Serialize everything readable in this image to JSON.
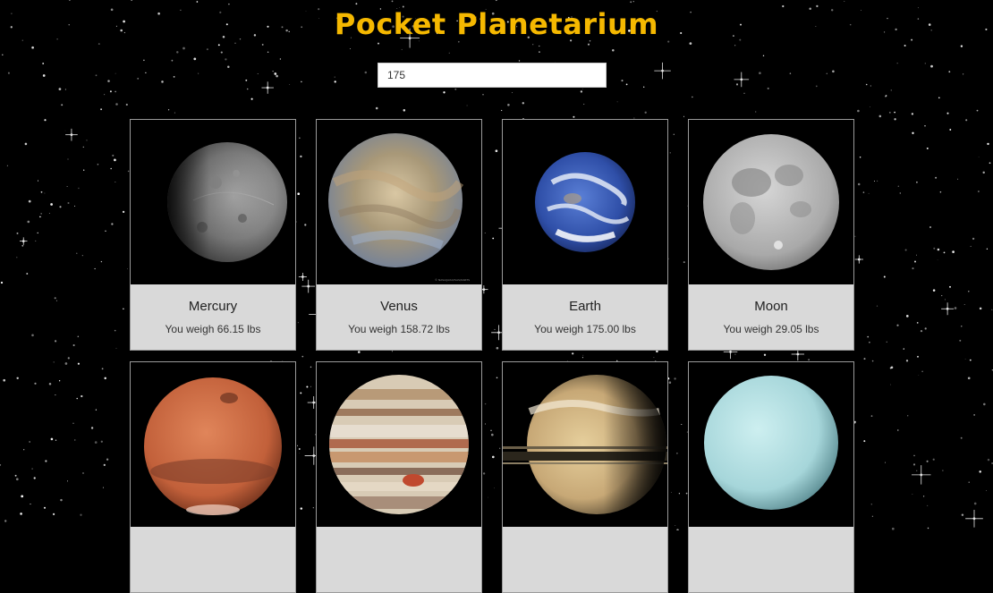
{
  "header": {
    "title": "Pocket Planetarium"
  },
  "search": {
    "value": "175"
  },
  "cards": [
    {
      "name": "Mercury",
      "weight_text": "You weigh 66.15 lbs"
    },
    {
      "name": "Venus",
      "weight_text": "You weigh 158.72 lbs"
    },
    {
      "name": "Earth",
      "weight_text": "You weigh 175.00 lbs"
    },
    {
      "name": "Moon",
      "weight_text": "You weigh 29.05 lbs"
    },
    {
      "name": "",
      "weight_text": ""
    },
    {
      "name": "",
      "weight_text": ""
    },
    {
      "name": "",
      "weight_text": ""
    },
    {
      "name": "",
      "weight_text": ""
    }
  ],
  "colors": {
    "title": "#f5b800",
    "card_info_bg": "#d9d9d9",
    "background": "#000000"
  }
}
